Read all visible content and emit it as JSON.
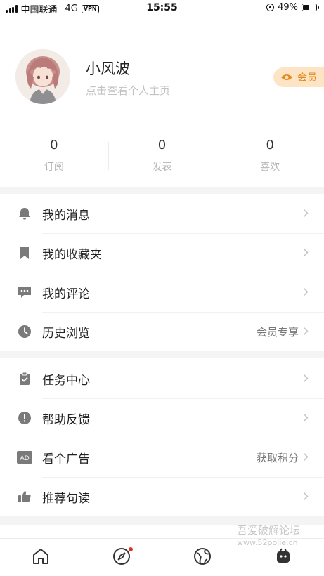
{
  "status_bar": {
    "carrier": "中国联通",
    "network": "4G",
    "vpn": "VPN",
    "time": "15:55",
    "battery": "49%",
    "battery_level": 0.49
  },
  "profile": {
    "name": "小风波",
    "subtitle": "点击查看个人主页",
    "vip_label": "会员"
  },
  "stats": [
    {
      "value": "0",
      "label": "订阅"
    },
    {
      "value": "0",
      "label": "发表"
    },
    {
      "value": "0",
      "label": "喜欢"
    }
  ],
  "menu_group_1": [
    {
      "label": "我的消息",
      "icon": "bell-icon",
      "extra": ""
    },
    {
      "label": "我的收藏夹",
      "icon": "bookmark-icon",
      "extra": ""
    },
    {
      "label": "我的评论",
      "icon": "comment-icon",
      "extra": ""
    },
    {
      "label": "历史浏览",
      "icon": "clock-icon",
      "extra": "会员专享"
    }
  ],
  "menu_group_2": [
    {
      "label": "任务中心",
      "icon": "clipboard-check-icon",
      "extra": ""
    },
    {
      "label": "帮助反馈",
      "icon": "exclamation-icon",
      "extra": ""
    },
    {
      "label": "看个广告",
      "icon": "ad-icon",
      "ad_text": "AD",
      "extra": "获取积分"
    },
    {
      "label": "推荐句读",
      "icon": "thumbs-up-icon",
      "extra": ""
    }
  ],
  "tabs": [
    {
      "name": "home",
      "icon": "home-icon",
      "has_dot": false
    },
    {
      "name": "discover",
      "icon": "compass-icon",
      "has_dot": true
    },
    {
      "name": "world",
      "icon": "globe-icon",
      "has_dot": false
    },
    {
      "name": "me",
      "icon": "profile-icon",
      "has_dot": false
    }
  ],
  "watermark": {
    "text": "吾爱破解论坛",
    "url": "www.52pojie.cn"
  },
  "colors": {
    "accent": "#e3891c",
    "vip_bg": "#fde4c4",
    "divider": "#f4f4f4",
    "icon_gray": "#7a7a7a",
    "notify_dot": "#e0322c"
  }
}
